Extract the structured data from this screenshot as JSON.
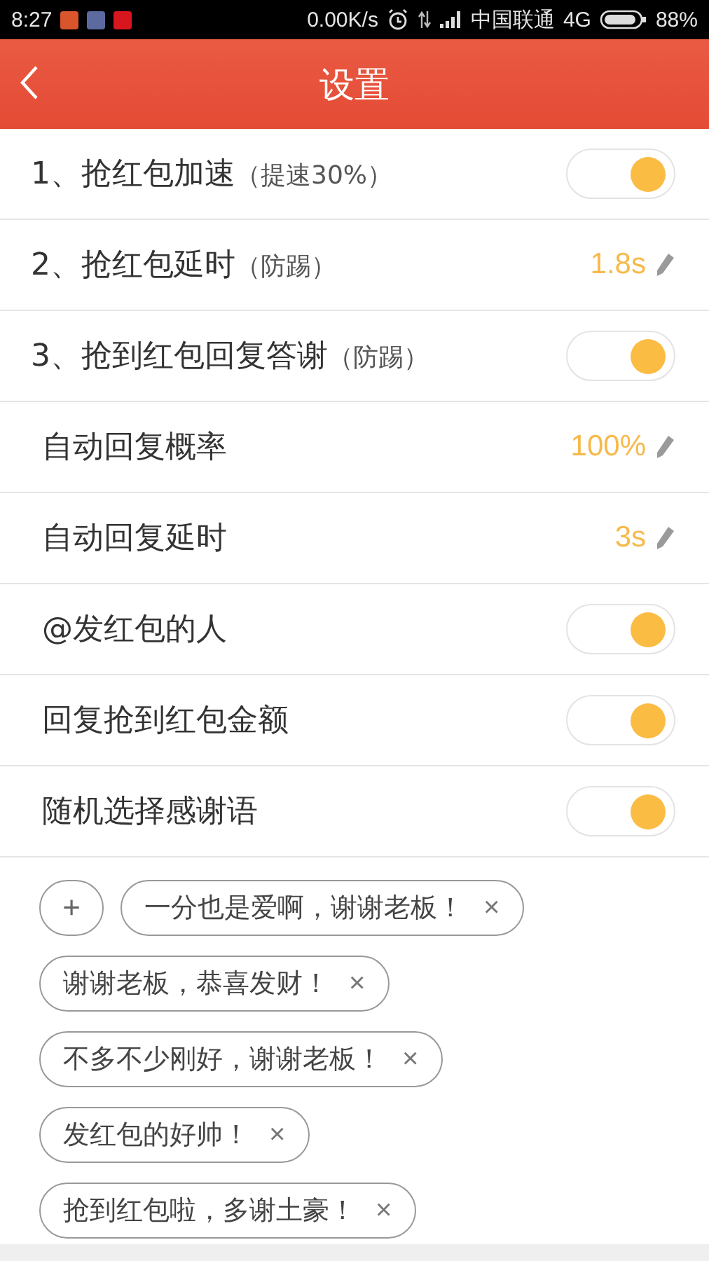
{
  "status_bar": {
    "time": "8:27",
    "speed": "0.00K/s",
    "carrier": "中国联通",
    "network": "4G",
    "battery": "88%"
  },
  "header": {
    "title": "设置"
  },
  "settings": [
    {
      "kind": "toggle",
      "label": "1、抢红包加速",
      "note": "（提速30%）",
      "sub": false,
      "on": true
    },
    {
      "kind": "value",
      "label": "2、抢红包延时",
      "note": "（防踢）",
      "sub": false,
      "value": "1.8s"
    },
    {
      "kind": "toggle",
      "label": "3、抢到红包回复答谢",
      "note": "（防踢）",
      "sub": false,
      "on": true
    },
    {
      "kind": "value",
      "label": "自动回复概率",
      "sub": true,
      "value": "100%"
    },
    {
      "kind": "value",
      "label": "自动回复延时",
      "sub": true,
      "value": "3s"
    },
    {
      "kind": "toggle",
      "label": "@发红包的人",
      "sub": true,
      "on": true
    },
    {
      "kind": "toggle",
      "label": "回复抢到红包金额",
      "sub": true,
      "on": true
    },
    {
      "kind": "toggle",
      "label": "随机选择感谢语",
      "sub": true,
      "on": true
    }
  ],
  "add_button": "+",
  "phrases": [
    {
      "text": "一分也是爱啊，谢谢老板！",
      "remove": "×"
    },
    {
      "text": "谢谢老板，恭喜发财！",
      "remove": "×"
    },
    {
      "text": "不多不少刚好，谢谢老板！",
      "remove": "×"
    },
    {
      "text": "发红包的好帅！",
      "remove": "×"
    },
    {
      "text": "抢到红包啦，多谢土豪！",
      "remove": "×"
    }
  ]
}
